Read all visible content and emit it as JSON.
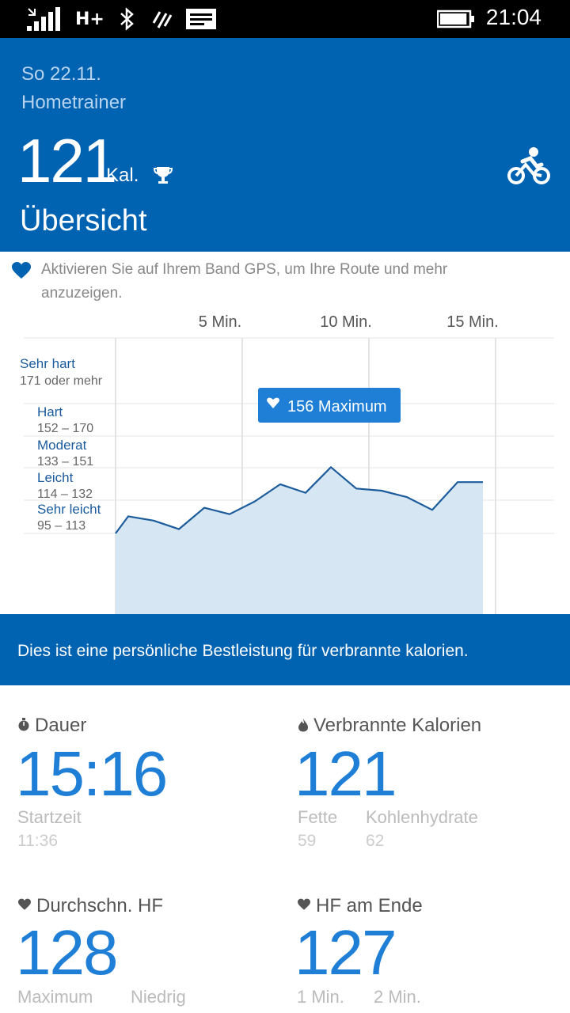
{
  "status_bar": {
    "network": "H+",
    "time": "21:04",
    "battery_level": 0.95
  },
  "header": {
    "date": "So 22.11.",
    "activity": "Hometrainer",
    "calories": "121",
    "calories_unit": "Kal.",
    "title": "Übersicht",
    "color": "#0063b1"
  },
  "gps_notice": "Aktivieren Sie auf Ihrem Band GPS, um Ihre Route und mehr anzuzeigen.",
  "chart_data": {
    "type": "area",
    "x_ticks": [
      "5 Min.",
      "10 Min.",
      "15 Min."
    ],
    "zones": [
      {
        "name": "Sehr hart",
        "range": "171 oder mehr"
      },
      {
        "name": "Hart",
        "range": "152 – 170"
      },
      {
        "name": "Moderat",
        "range": "133 – 151"
      },
      {
        "name": "Leicht",
        "range": "114 – 132"
      },
      {
        "name": "Sehr leicht",
        "range": "95 – 113"
      }
    ],
    "x": [
      0,
      0.5,
      1.5,
      2.5,
      3.5,
      4.5,
      5.5,
      6.5,
      7.5,
      8.5,
      9.5,
      10.5,
      11.5,
      12.5,
      13.5,
      14.5
    ],
    "y": [
      95,
      103,
      101,
      97,
      107,
      104,
      110,
      118,
      114,
      126,
      116,
      115,
      112,
      106,
      119,
      119
    ],
    "max_label": "156 Maximum",
    "line_color": "#1d5c9c",
    "fill_color": "#d6e6f2"
  },
  "banner": {
    "text": "Dies ist eine persönliche Bestleistung für verbrannte kalorien."
  },
  "stats": {
    "duration": {
      "label": "Dauer",
      "value": "15:16",
      "sub_label": "Startzeit",
      "sub_value": "11:36"
    },
    "calories": {
      "label": "Verbrannte Kalorien",
      "value": "121",
      "fat_label": "Fette",
      "fat_value": "59",
      "carb_label": "Kohlenhydrate",
      "carb_value": "62"
    },
    "avg_hr": {
      "label": "Durchschn. HF",
      "value": "128",
      "max_label": "Maximum",
      "low_label": "Niedrig"
    },
    "end_hr": {
      "label": "HF am Ende",
      "value": "127",
      "min1_label": "1 Min.",
      "min2_label": "2 Min."
    }
  }
}
